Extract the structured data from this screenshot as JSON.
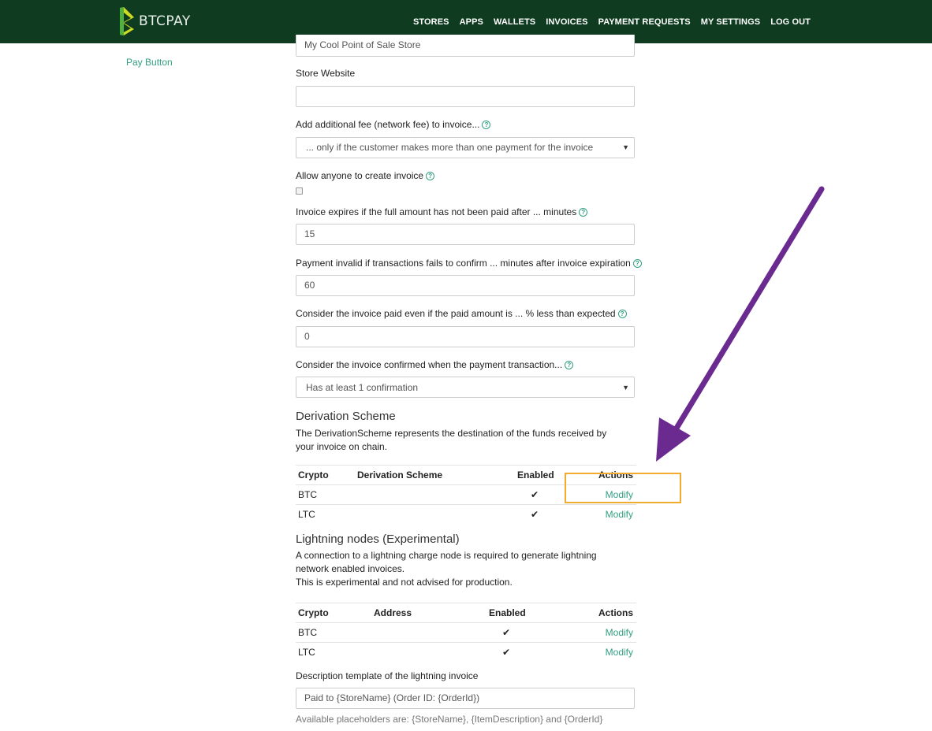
{
  "brand": {
    "name": "BTCPAY",
    "color": "#0f3b21",
    "accent": "#329f80"
  },
  "nav": {
    "items": [
      "STORES",
      "APPS",
      "WALLETS",
      "INVOICES",
      "PAYMENT REQUESTS",
      "MY SETTINGS",
      "LOG OUT"
    ]
  },
  "sidebar": {
    "items": [
      {
        "label": "Pay Button"
      }
    ]
  },
  "form": {
    "store_name_value": "My Cool Point of Sale Store",
    "store_website": {
      "label": "Store Website",
      "value": ""
    },
    "network_fee": {
      "label": "Add additional fee (network fee) to invoice...",
      "selected": "... only if the customer makes more than one payment for the invoice"
    },
    "allow_anyone": {
      "label": "Allow anyone to create invoice",
      "checked": false
    },
    "invoice_expiry": {
      "label": "Invoice expires if the full amount has not been paid after ... minutes",
      "value": "15"
    },
    "payment_invalid": {
      "label": "Payment invalid if transactions fails to confirm ... minutes after invoice expiration",
      "value": "60"
    },
    "paid_tolerance": {
      "label": "Consider the invoice paid even if the paid amount is ... % less than expected",
      "value": "0"
    },
    "speed_policy": {
      "label": "Consider the invoice confirmed when the payment transaction...",
      "selected": "Has at least 1 confirmation"
    }
  },
  "derivation": {
    "title": "Derivation Scheme",
    "description": "The DerivationScheme represents the destination of the funds received by your invoice on chain.",
    "columns": [
      "Crypto",
      "Derivation Scheme",
      "Enabled",
      "Actions"
    ],
    "rows": [
      {
        "crypto": "BTC",
        "scheme": "",
        "enabled": "✔",
        "action": "Modify"
      },
      {
        "crypto": "LTC",
        "scheme": "",
        "enabled": "✔",
        "action": "Modify"
      }
    ]
  },
  "lightning": {
    "title": "Lightning nodes (Experimental)",
    "description_1": "A connection to a lightning charge node is required to generate lightning network enabled invoices.",
    "description_2": "This is experimental and not advised for production.",
    "columns": [
      "Crypto",
      "Address",
      "Enabled",
      "Actions"
    ],
    "rows": [
      {
        "crypto": "BTC",
        "address": "",
        "enabled": "✔",
        "action": "Modify"
      },
      {
        "crypto": "LTC",
        "address": "",
        "enabled": "✔",
        "action": "Modify"
      }
    ]
  },
  "lightning_description": {
    "label": "Description template of the lightning invoice",
    "value": "Paid to {StoreName} (Order ID: {OrderId})",
    "help": "Available placeholders are: {StoreName}, {ItemDescription} and {OrderId}"
  },
  "annotation": {
    "arrow_color": "#6a2a8f",
    "highlight_color": "#f2ab2c"
  }
}
